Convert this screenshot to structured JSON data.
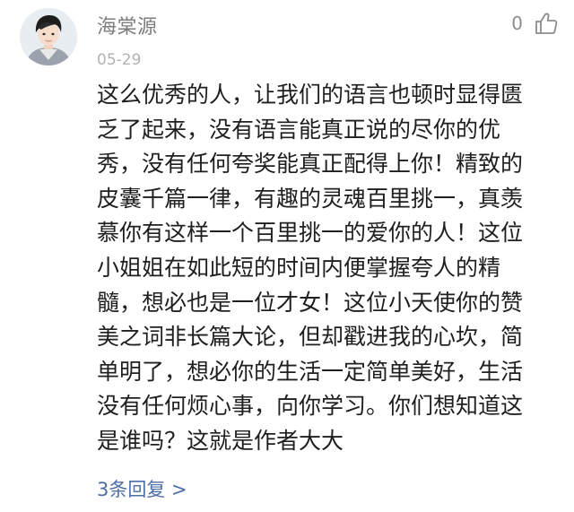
{
  "comment": {
    "username": "海棠源",
    "date": "05-29",
    "like_count": "0",
    "like_icon": "thumbs-up-outline-icon",
    "avatar_icon": "user-avatar-photo",
    "body_lines": [
      "这么优秀的人，让我们的语言也顿时显得匮",
      "乏了起来，没有语言能真正说的尽你的优",
      "秀，没有任何夸奖能真正配得上你！精致的",
      "皮囊千篇一律，有趣的灵魂百里挑一，真羡",
      "慕你有这样一个百里挑一的爱你的人！这位",
      "小姐姐在如此短的时间内便掌握夸人的精",
      "髓，想必也是一位才女！这位小天使你的赞",
      "美之词非长篇大论，但却戳进我的心坎，简",
      "单明了，想必你的生活一定简单美好，生活",
      "没有任何烦心事，向你学习。你们想知道这",
      "是谁吗？这就是作者大大"
    ],
    "replies_label": "3条回复 >",
    "colors": {
      "username": "#7d7d7d",
      "date": "#b2b2b2",
      "body": "#1f1f1f",
      "link": "#4e6ea7"
    }
  }
}
